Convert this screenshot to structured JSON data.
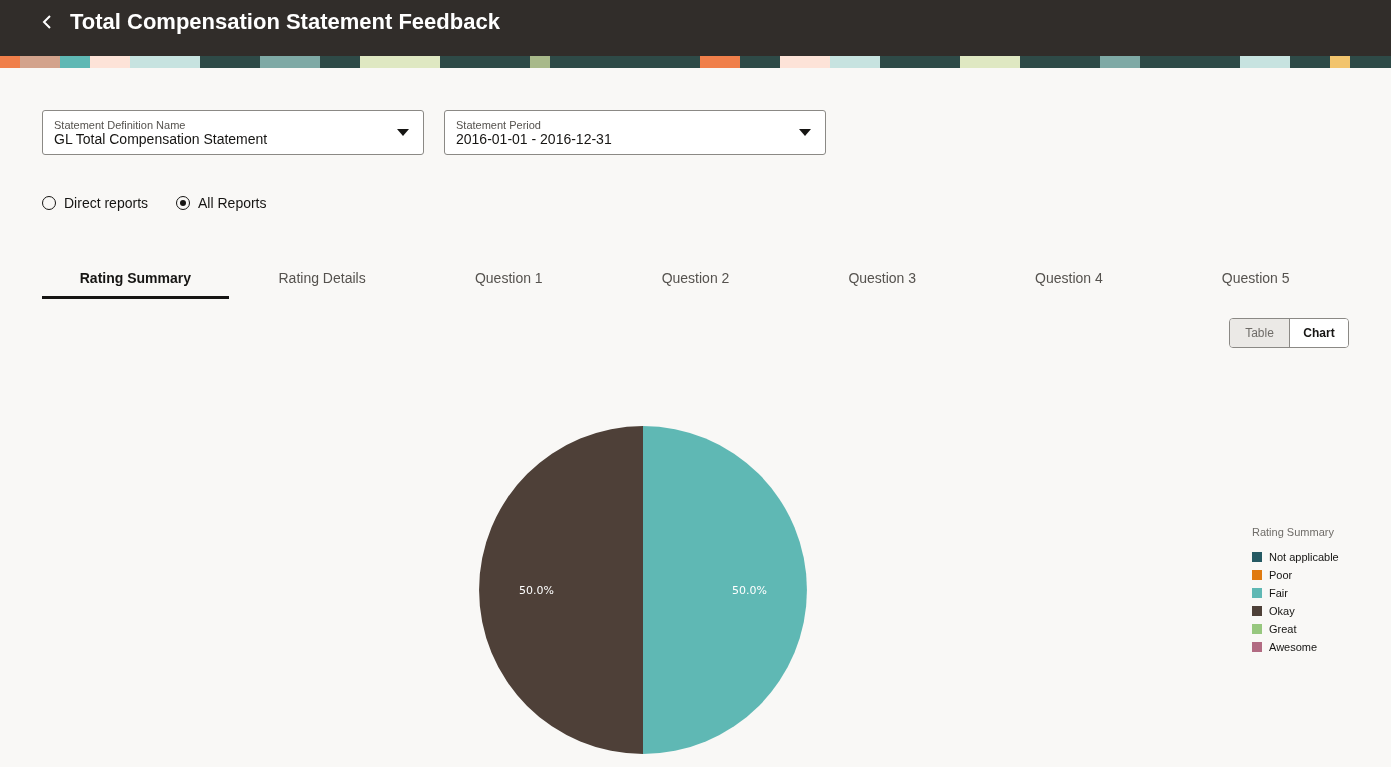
{
  "header": {
    "title": "Total Compensation Statement Feedback"
  },
  "filters": [
    {
      "label": "Statement Definition Name",
      "value": "GL Total Compensation Statement"
    },
    {
      "label": "Statement Period",
      "value": "2016-01-01 - 2016-12-31"
    }
  ],
  "report_scope": [
    {
      "label": "Direct reports",
      "selected": false
    },
    {
      "label": "All Reports",
      "selected": true
    }
  ],
  "tabs": [
    {
      "label": "Rating Summary",
      "selected": true
    },
    {
      "label": "Rating Details",
      "selected": false
    },
    {
      "label": "Question 1",
      "selected": false
    },
    {
      "label": "Question 2",
      "selected": false
    },
    {
      "label": "Question 3",
      "selected": false
    },
    {
      "label": "Question 4",
      "selected": false
    },
    {
      "label": "Question 5",
      "selected": false
    }
  ],
  "view_toggle": [
    {
      "label": "Table",
      "selected": false
    },
    {
      "label": "Chart",
      "selected": true
    }
  ],
  "chart_data": {
    "type": "pie",
    "legend": true,
    "categories": [
      "Not applicable",
      "Poor",
      "Fair",
      "Okay",
      "Great",
      "Awesome"
    ],
    "series": [
      {
        "name": "Rating Summary",
        "colors": [
          "#255a63",
          "#e07a10",
          "#5fb8b4",
          "#4e4038",
          "#97c77e",
          "#b26b82"
        ],
        "values": [
          0,
          0,
          50,
          50,
          0,
          0
        ]
      }
    ],
    "value_labels": [
      null,
      null,
      "50.0%",
      "50.0%",
      null,
      null
    ]
  }
}
